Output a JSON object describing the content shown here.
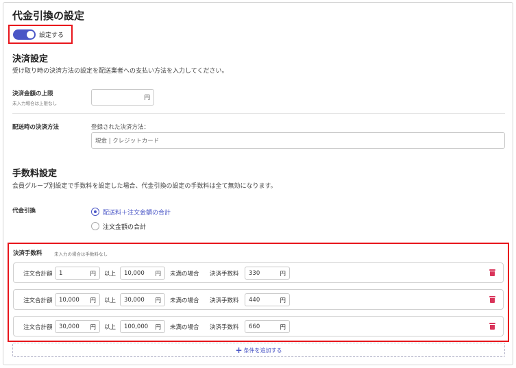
{
  "page": {
    "title": "代金引換の設定"
  },
  "toggle": {
    "label": "設定する",
    "on": true,
    "color": "#4a56c6"
  },
  "payment_settings": {
    "title": "決済設定",
    "description": "受け取り時の決済方法の設定を配送業者への支払い方法を入力してください。",
    "limit": {
      "label": "決済金額の上限",
      "sublabel": "未入力場合は上限なし",
      "value": "",
      "unit": "円"
    },
    "method": {
      "label": "配送時の決済方法",
      "caption": "登録された決済方法：",
      "value": "現金 | クレジットカード"
    }
  },
  "fee_settings": {
    "title": "手数料設定",
    "description": "会員グループ別設定で手数料を設定した場合、代金引換の設定の手数料は全て無効になります。",
    "cod_label": "代金引換",
    "options": [
      {
        "label": "配送料＋注文金額の合計",
        "selected": true
      },
      {
        "label": "注文金額の合計",
        "selected": false
      }
    ]
  },
  "fees": {
    "title": "決済手数料",
    "note": "未入力の場合は手数料なし",
    "total_label": "注文合計額",
    "from_suffix": "以上",
    "to_suffix": "未満の場合",
    "fee_label": "決済手数料",
    "unit": "円",
    "rows": [
      {
        "from": "1",
        "to": "10,000",
        "fee": "330"
      },
      {
        "from": "10,000",
        "to": "30,000",
        "fee": "440"
      },
      {
        "from": "30,000",
        "to": "100,000",
        "fee": "660"
      }
    ],
    "add_label": "条件を追加する"
  },
  "colors": {
    "accent": "#4a56c6",
    "highlight": "#e8151b",
    "delete": "#d9345a"
  }
}
